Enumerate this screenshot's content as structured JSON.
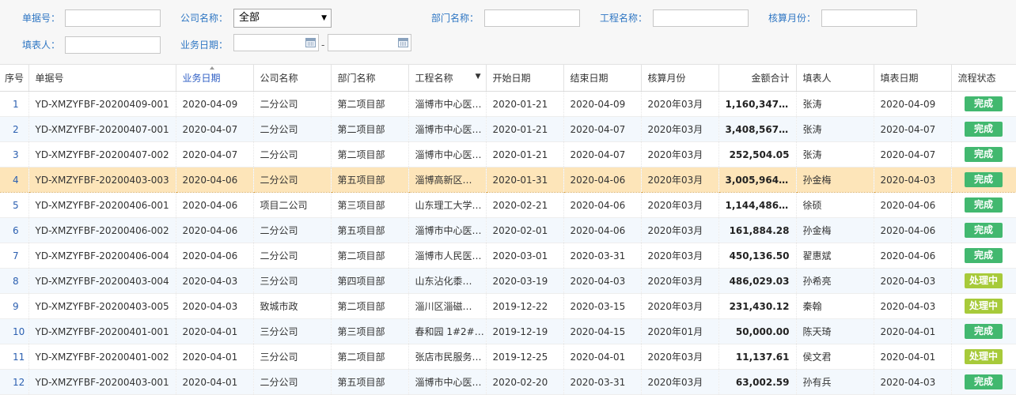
{
  "filters": {
    "doc_no_label": "单据号：",
    "company_label": "公司名称：",
    "company_value": "全部",
    "dept_label": "部门名称：",
    "project_label": "工程名称：",
    "month_label": "核算月份：",
    "filler_label": "填表人：",
    "bizdate_label": "业务日期：",
    "range_sep": "-"
  },
  "table": {
    "columns": [
      "序号",
      "单据号",
      "业务日期",
      "公司名称",
      "部门名称",
      "工程名称",
      "开始日期",
      "结束日期",
      "核算月份",
      "金额合计",
      "填表人",
      "填表日期",
      "流程状态"
    ],
    "rows": [
      {
        "seq": "1",
        "doc": "YD-XMZYFBF-20200409-001",
        "bizdate": "2020-04-09",
        "company": "二分公司",
        "dept": "第二项目部",
        "project": "淄博市中心医院…",
        "start": "2020-01-21",
        "end": "2020-04-09",
        "month": "2020年03月",
        "amount": "1,160,347.51",
        "filler": "张涛",
        "filldate": "2020-04-09",
        "status": "完成"
      },
      {
        "seq": "2",
        "doc": "YD-XMZYFBF-20200407-001",
        "bizdate": "2020-04-07",
        "company": "二分公司",
        "dept": "第二项目部",
        "project": "淄博市中心医院…",
        "start": "2020-01-21",
        "end": "2020-04-07",
        "month": "2020年03月",
        "amount": "3,408,567.20",
        "filler": "张涛",
        "filldate": "2020-04-07",
        "status": "完成"
      },
      {
        "seq": "3",
        "doc": "YD-XMZYFBF-20200407-002",
        "bizdate": "2020-04-07",
        "company": "二分公司",
        "dept": "第二项目部",
        "project": "淄博市中心医院…",
        "start": "2020-01-21",
        "end": "2020-04-07",
        "month": "2020年03月",
        "amount": "252,504.05",
        "filler": "张涛",
        "filldate": "2020-04-07",
        "status": "完成"
      },
      {
        "seq": "4",
        "doc": "YD-XMZYFBF-20200403-003",
        "bizdate": "2020-04-06",
        "company": "二分公司",
        "dept": "第五项目部",
        "project": "淄博高新区…",
        "start": "2020-01-31",
        "end": "2020-04-06",
        "month": "2020年03月",
        "amount": "3,005,964.53",
        "filler": "孙金梅",
        "filldate": "2020-04-03",
        "status": "完成"
      },
      {
        "seq": "5",
        "doc": "YD-XMZYFBF-20200406-001",
        "bizdate": "2020-04-06",
        "company": "项目二公司",
        "dept": "第三项目部",
        "project": "山东理工大学…",
        "start": "2020-02-21",
        "end": "2020-04-06",
        "month": "2020年03月",
        "amount": "1,144,486.07",
        "filler": "徐硕",
        "filldate": "2020-04-06",
        "status": "完成"
      },
      {
        "seq": "6",
        "doc": "YD-XMZYFBF-20200406-002",
        "bizdate": "2020-04-06",
        "company": "二分公司",
        "dept": "第五项目部",
        "project": "淄博市中心医院…",
        "start": "2020-02-01",
        "end": "2020-04-06",
        "month": "2020年03月",
        "amount": "161,884.28",
        "filler": "孙金梅",
        "filldate": "2020-04-06",
        "status": "完成"
      },
      {
        "seq": "7",
        "doc": "YD-XMZYFBF-20200406-004",
        "bizdate": "2020-04-06",
        "company": "二分公司",
        "dept": "第二项目部",
        "project": "淄博市人民医院…",
        "start": "2020-03-01",
        "end": "2020-03-31",
        "month": "2020年03月",
        "amount": "450,136.50",
        "filler": "翟惠斌",
        "filldate": "2020-04-06",
        "status": "完成"
      },
      {
        "seq": "8",
        "doc": "YD-XMZYFBF-20200403-004",
        "bizdate": "2020-04-03",
        "company": "三分公司",
        "dept": "第四项目部",
        "project": "山东沾化黍…",
        "start": "2020-03-19",
        "end": "2020-04-03",
        "month": "2020年03月",
        "amount": "486,029.03",
        "filler": "孙希亮",
        "filldate": "2020-04-03",
        "status": "处理中"
      },
      {
        "seq": "9",
        "doc": "YD-XMZYFBF-20200403-005",
        "bizdate": "2020-04-03",
        "company": "致城市政",
        "dept": "第二项目部",
        "project": "淄川区淄磁…",
        "start": "2019-12-22",
        "end": "2020-03-15",
        "month": "2020年03月",
        "amount": "231,430.12",
        "filler": "秦翰",
        "filldate": "2020-04-03",
        "status": "处理中"
      },
      {
        "seq": "10",
        "doc": "YD-XMZYFBF-20200401-001",
        "bizdate": "2020-04-01",
        "company": "三分公司",
        "dept": "第三项目部",
        "project": "春和园 1#2#…",
        "start": "2019-12-19",
        "end": "2020-04-15",
        "month": "2020年01月",
        "amount": "50,000.00",
        "filler": "陈天琦",
        "filldate": "2020-04-01",
        "status": "完成"
      },
      {
        "seq": "11",
        "doc": "YD-XMZYFBF-20200401-002",
        "bizdate": "2020-04-01",
        "company": "三分公司",
        "dept": "第二项目部",
        "project": "张店市民服务…",
        "start": "2019-12-25",
        "end": "2020-04-01",
        "month": "2020年03月",
        "amount": "11,137.61",
        "filler": "侯文君",
        "filldate": "2020-04-01",
        "status": "处理中"
      },
      {
        "seq": "12",
        "doc": "YD-XMZYFBF-20200403-001",
        "bizdate": "2020-04-01",
        "company": "二分公司",
        "dept": "第五项目部",
        "project": "淄博市中心医院…",
        "start": "2020-02-20",
        "end": "2020-03-31",
        "month": "2020年03月",
        "amount": "63,002.59",
        "filler": "孙有兵",
        "filldate": "2020-04-03",
        "status": "完成"
      }
    ]
  },
  "colors": {
    "accent_label": "#2e76c3",
    "done": "#42b86f",
    "processing": "#a7ca3a",
    "selected_row": "#fde5b9"
  }
}
